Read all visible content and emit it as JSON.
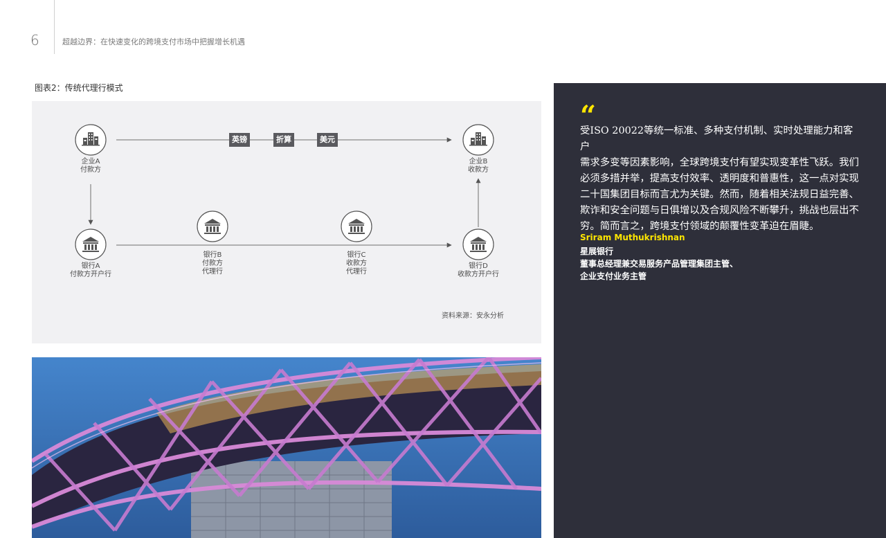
{
  "header": {
    "page_number": "6",
    "running_title": "超越边界：在快速变化的跨境支付市场中把握增长机遇"
  },
  "figure": {
    "caption": "图表2：传统代理行模式",
    "nodes": {
      "company_a": {
        "line1": "企业A",
        "line2": "付款方",
        "icon": "office-building-icon"
      },
      "company_b": {
        "line1": "企业B",
        "line2": "收款方",
        "icon": "office-building-icon"
      },
      "bank_a": {
        "line1": "银行A",
        "line2": "付款方开户行",
        "icon": "bank-icon"
      },
      "bank_b": {
        "line1": "银行B",
        "line2": "付款方",
        "line3": "代理行",
        "icon": "bank-icon"
      },
      "bank_c": {
        "line1": "银行C",
        "line2": "收款方",
        "line3": "代理行",
        "icon": "bank-icon"
      },
      "bank_d": {
        "line1": "银行D",
        "line2": "收款方开户行",
        "icon": "bank-icon"
      }
    },
    "currency_tags": [
      "英镑",
      "折算",
      "美元"
    ],
    "source": "资料来源：安永分析",
    "colors": {
      "panel": "#f1f1f3",
      "tag": "#5a5a5e",
      "line": "#6e6e6e"
    }
  },
  "quote": {
    "mark": "“",
    "lines": [
      "受ISO 20022等统一标准、多种支付机制、实时处理能力和客户",
      "需求多变等因素影响，全球跨境支付有望实现变革性飞跃。我们",
      "必须多措并举，提高支付效率、透明度和普惠性，这一点对实现",
      "二十国集团目标而言尤为关键。然而，随着相关法规日益完善、",
      "欺诈和安全问题与日俱增以及合规风险不断攀升，挑战也层出不",
      "穷。简而言之，跨境支付领域的颠覆性变革迫在眉睫。"
    ],
    "author": "Sriram Muthukrishnan",
    "organization": "星展银行",
    "title_line1": "董事总经理兼交易服务产品管理集团主管、",
    "title_line2": "企业支付业务主管",
    "colors": {
      "panel": "#2e2f3a",
      "accent": "#ffe600"
    }
  }
}
